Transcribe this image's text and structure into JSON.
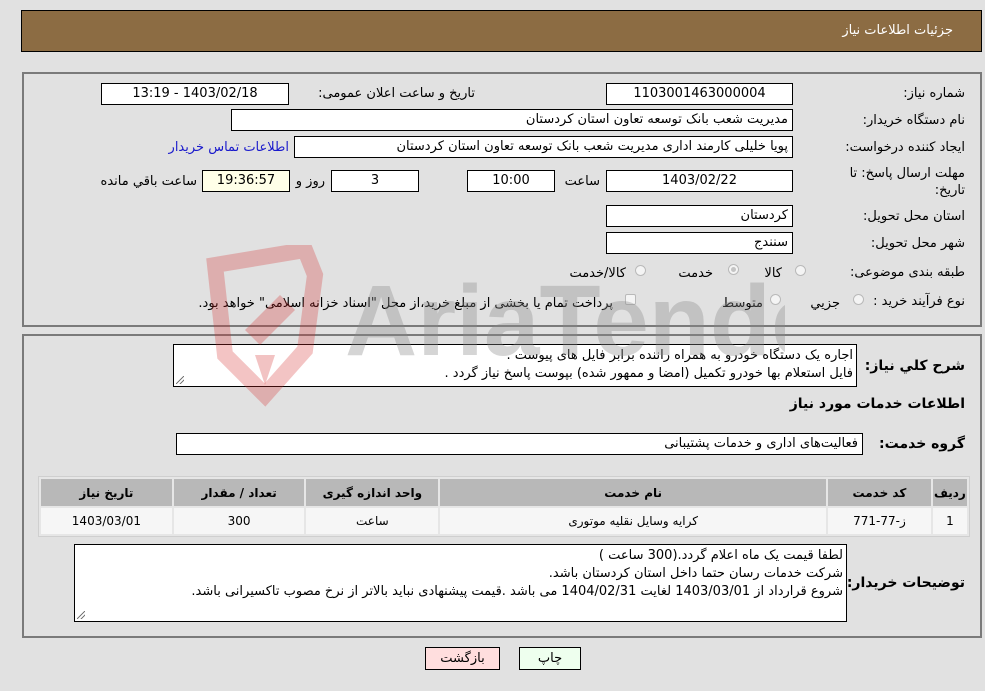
{
  "header": {
    "title": "جزئیات اطلاعات نیاز"
  },
  "form": {
    "need_number": {
      "label": "شماره نیاز:",
      "value": "1103001463000004"
    },
    "announce": {
      "label": "تاریخ و ساعت اعلان عمومی:",
      "value": "1403/02/18 - 13:19"
    },
    "buyer_org": {
      "label": "نام دستگاه خریدار:",
      "value": "مدیریت شعب بانک توسعه تعاون استان کردستان"
    },
    "creator": {
      "label": "ایجاد کننده درخواست:",
      "value": "پویا خلیلی کارمند اداری مدیریت شعب بانک توسعه تعاون استان کردستان",
      "contact_link": "اطلاعات تماس خریدار"
    },
    "deadline": {
      "label_line1": "مهلت ارسال پاسخ: تا",
      "label_line2": "تاریخ:",
      "date": "1403/02/22",
      "time_label": "ساعت",
      "time": "10:00",
      "days": "3",
      "days_label": "روز و",
      "remaining": "19:36:57",
      "remaining_label": "ساعت باقي مانده"
    },
    "province": {
      "label": "استان محل تحویل:",
      "value": "کردستان"
    },
    "city": {
      "label": "شهر محل تحویل:",
      "value": "سنندج"
    },
    "category": {
      "label": "طبقه بندی موضوعی:",
      "options": [
        {
          "label": "کالا",
          "checked": false
        },
        {
          "label": "خدمت",
          "checked": true
        },
        {
          "label": "کالا/خدمت",
          "checked": false
        }
      ]
    },
    "process": {
      "label": "نوع فرآیند خرید :",
      "options": [
        {
          "label": "جزيي",
          "checked": false
        },
        {
          "label": "متوسط",
          "checked": false
        }
      ],
      "payment_note": "پرداخت تمام یا بخشی از مبلغ خرید،از محل \"اسناد خزانه اسلامی\" خواهد بود."
    }
  },
  "description": {
    "label": "شرح کلي نياز:",
    "lines": [
      "اجاره یک دستگاه خودرو به همراه راننده برابر فایل های پیوست .",
      "فایل استعلام بها خودرو تکمیل (امضا و ممهور شده) بپوست پاسخ نیاز گردد ."
    ]
  },
  "services": {
    "title": "اطلاعات خدمات مورد نياز",
    "group_label": "گروه خدمت:",
    "group_value": "فعالیت‌های اداری و خدمات پشتیبانی",
    "table": {
      "headers": [
        "ردیف",
        "کد خدمت",
        "نام خدمت",
        "واحد اندازه گیری",
        "تعداد / مقدار",
        "تاریخ نیاز"
      ],
      "rows": [
        [
          "1",
          "ز-77-771",
          "کرایه وسایل نقلیه موتوری",
          "ساعت",
          "300",
          "1403/03/01"
        ]
      ]
    }
  },
  "buyer_notes": {
    "label": "توضیحات خریدار:",
    "lines": [
      "لطفا قیمت یک ماه اعلام گردد.(300 ساعت )",
      "شرکت خدمات رسان حتما داخل استان کردستان باشد.",
      "شروع قرارداد از 1403/03/01 لغایت 1404/02/31 می باشد .قیمت پیشنهادی نباید بالاتر از نرخ مصوب تاکسیرانی باشد."
    ]
  },
  "buttons": {
    "print": "چاپ",
    "back": "بازگشت"
  },
  "watermark": {
    "text": "AriaTender.neT"
  },
  "colors": {
    "header_bg": "#8c6c43",
    "print_bg": "#eeffee",
    "back_bg": "#ffdede",
    "link": "#1a1acc"
  }
}
